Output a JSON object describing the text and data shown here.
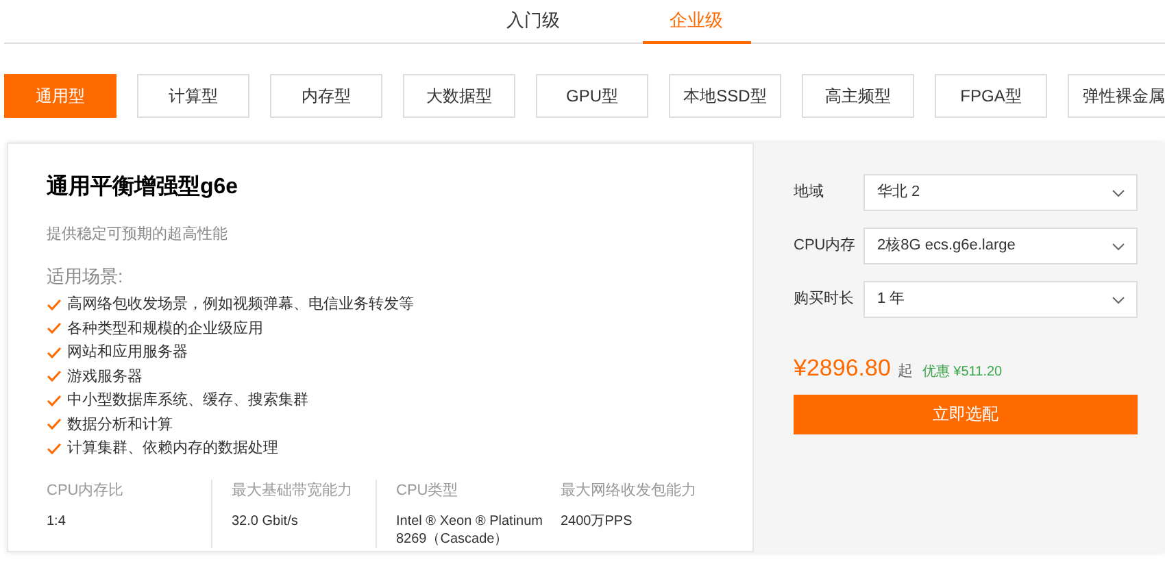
{
  "tiers": [
    {
      "label": "入门级",
      "selected": false
    },
    {
      "label": "企业级",
      "selected": true
    }
  ],
  "categories": [
    {
      "label": "通用型",
      "selected": true
    },
    {
      "label": "计算型",
      "selected": false
    },
    {
      "label": "内存型",
      "selected": false
    },
    {
      "label": "大数据型",
      "selected": false
    },
    {
      "label": "GPU型",
      "selected": false
    },
    {
      "label": "本地SSD型",
      "selected": false
    },
    {
      "label": "高主频型",
      "selected": false
    },
    {
      "label": "FPGA型",
      "selected": false
    },
    {
      "label": "弹性裸金属",
      "selected": false
    }
  ],
  "product": {
    "title": "通用平衡增强型g6e",
    "subtitle": "提供稳定可预期的超高性能",
    "scenarios_heading": "适用场景:",
    "scenarios": [
      "高网络包收发场景，例如视频弹幕、电信业务转发等",
      "各种类型和规模的企业级应用",
      "网站和应用服务器",
      "游戏服务器",
      "中小型数据库系统、缓存、搜索集群",
      "数据分析和计算",
      "计算集群、依赖内存的数据处理"
    ],
    "specs": [
      {
        "label": "CPU内存比",
        "value": "1:4"
      },
      {
        "label": "最大基础带宽能力",
        "value": "32.0 Gbit/s"
      },
      {
        "label": "CPU类型",
        "value": "Intel ® Xeon ® Platinum 8269（Cascade）"
      },
      {
        "label": "最大网络收发包能力",
        "value": "2400万PPS"
      }
    ]
  },
  "config": {
    "fields": [
      {
        "label": "地域",
        "value": "华北 2"
      },
      {
        "label": "CPU内存",
        "value": "2核8G ecs.g6e.large"
      },
      {
        "label": "购买时长",
        "value": "1 年"
      }
    ],
    "price": "¥2896.80",
    "price_suffix": "起",
    "discount": "优惠 ¥511.20",
    "button": "立即选配"
  }
}
